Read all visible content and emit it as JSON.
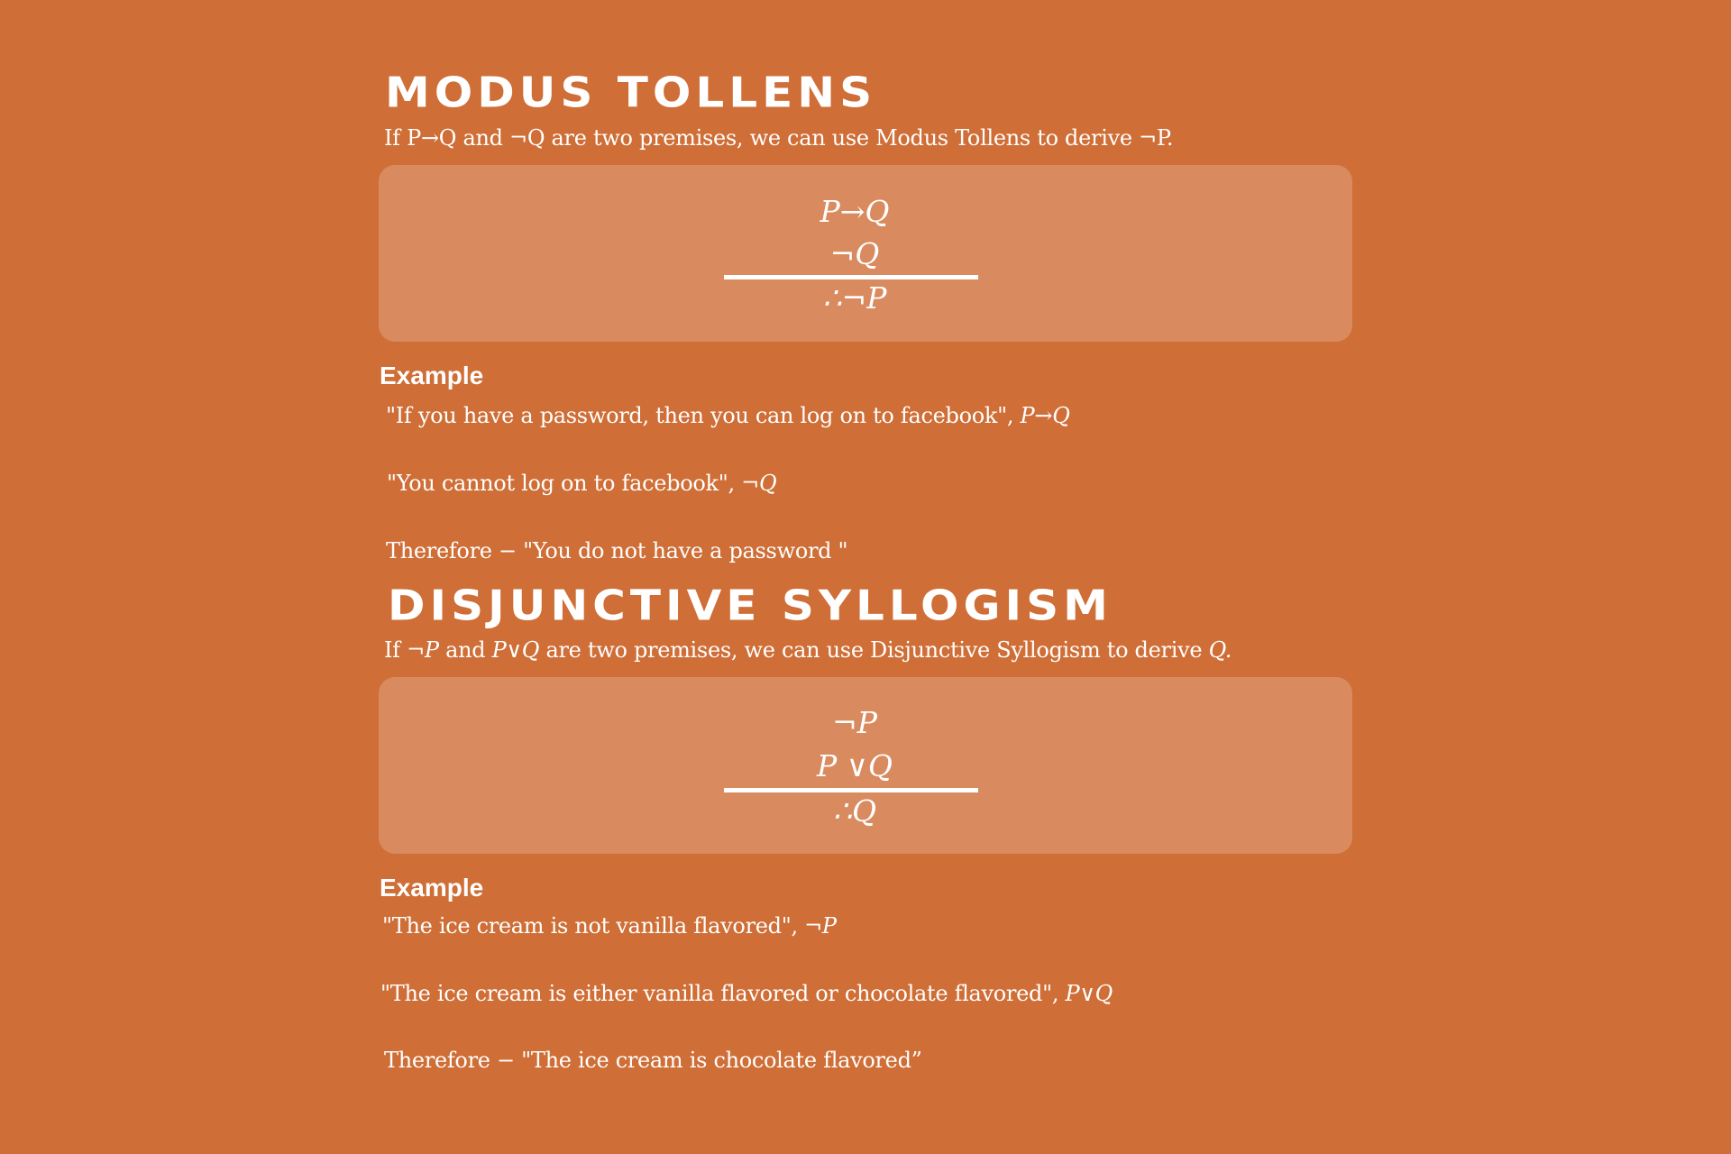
{
  "modus_tollens": {
    "title": "Modus Tollens",
    "intro": "If P→Q and ¬Q are two premises, we can use Modus Tollens to derive ¬P.",
    "formula": {
      "premise1": "P→Q",
      "premise2": "¬Q",
      "conclusion": "∴¬P"
    },
    "example_heading": "Example",
    "examples": [
      {
        "text": "\"If you have a password, then you can log on to facebook\", ",
        "symbol": "P→Q"
      },
      {
        "text": "\"You cannot log on to facebook\", ",
        "symbol": "¬Q"
      },
      {
        "text": "Therefore − \"You do not have a password \"",
        "symbol": ""
      }
    ]
  },
  "disjunctive_syllogism": {
    "title": "Disjunctive Syllogism",
    "intro": {
      "p1": "If ",
      "s1": "¬P",
      "p2": " and ",
      "s2": "P∨Q",
      "p3": " are two premises, we can use Disjunctive Syllogism to derive ",
      "s3": "Q.",
      "p4": ""
    },
    "formula": {
      "premise1": "¬P",
      "premise2": "P ∨Q",
      "conclusion": "∴Q"
    },
    "example_heading": "Example",
    "examples": [
      {
        "text": "\"The ice cream is not vanilla flavored\",  ",
        "symbol": "¬P"
      },
      {
        "text": "\"The ice cream is either vanilla flavored or chocolate flavored\",  ",
        "symbol": "P∨Q"
      },
      {
        "text": "Therefore − \"The ice cream is chocolate flavored”",
        "symbol": ""
      }
    ]
  }
}
